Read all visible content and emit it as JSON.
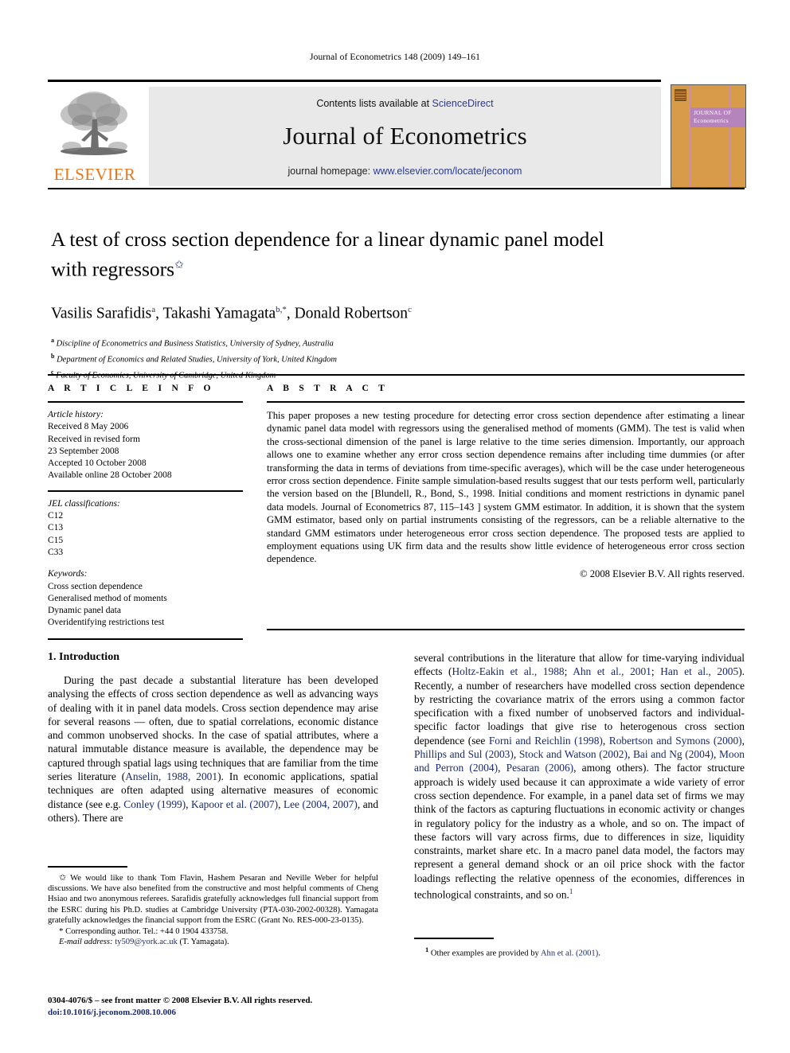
{
  "running_head": "Journal of Econometrics 148 (2009) 149–161",
  "masthead": {
    "contents_prefix": "Contents lists available at ",
    "contents_link": "ScienceDirect",
    "journal_title": "Journal of Econometrics",
    "homepage_prefix": "journal homepage: ",
    "homepage_url": "www.elsevier.com/locate/jeconom",
    "publisher": "ELSEVIER",
    "cover_title_line1": "JOURNAL OF",
    "cover_title_line2": "Econometrics",
    "accent_orange": "#E8761B",
    "band_grey": "#E9E9E9",
    "link_blue": "#2B3A8F",
    "cover_orange": "#D79B4A",
    "cover_purple": "#B584BD"
  },
  "title": {
    "line1": "A test of cross section dependence for a linear dynamic panel model",
    "line2": "with regressors",
    "star_mark": "✩"
  },
  "authors": {
    "full": "Vasilis Sarafidis a, Takashi Yamagata b,*, Donald Robertson c",
    "list": [
      {
        "name": "Vasilis Sarafidis",
        "mark": "a"
      },
      {
        "name": "Takashi Yamagata",
        "mark": "b,*"
      },
      {
        "name": "Donald Robertson",
        "mark": "c"
      }
    ],
    "affiliations": [
      {
        "mark": "a",
        "text": "Discipline of Econometrics and Business Statistics, University of Sydney, Australia"
      },
      {
        "mark": "b",
        "text": "Department of Economics and Related Studies, University of York, United Kingdom"
      },
      {
        "mark": "c",
        "text": "Faculty of Economics, University of Cambridge, United Kingdom"
      }
    ]
  },
  "article_info": {
    "heading": "A R T I C L E   I N F O",
    "history_label": "Article history:",
    "history": [
      "Received 8 May 2006",
      "Received in revised form",
      "23 September 2008",
      "Accepted 10 October 2008",
      "Available online 28 October 2008"
    ],
    "jel_label": "JEL classifications:",
    "jel": [
      "C12",
      "C13",
      "C15",
      "C33"
    ],
    "keywords_label": "Keywords:",
    "keywords": [
      "Cross section dependence",
      "Generalised method of moments",
      "Dynamic panel data",
      "Overidentifying restrictions test"
    ]
  },
  "abstract": {
    "heading": "A B S T R A C T",
    "text": "This paper proposes a new testing procedure for detecting error cross section dependence after estimating a linear dynamic panel data model with regressors using the generalised method of moments (GMM). The test is valid when the cross-sectional dimension of the panel is large relative to the time series dimension. Importantly, our approach allows one to examine whether any error cross section dependence remains after including time dummies (or after transforming the data in terms of deviations from time-specific averages), which will be the case under heterogeneous error cross section dependence. Finite sample simulation-based results suggest that our tests perform well, particularly the version based on the [Blundell, R., Bond, S., 1998. Initial conditions and moment restrictions in dynamic panel data models. Journal of Econometrics 87, 115–143 ] system GMM estimator. In addition, it is shown that the system GMM estimator, based only on partial instruments consisting of the regressors, can be a reliable alternative to the standard GMM estimators under heterogeneous error cross section dependence. The proposed tests are applied to employment equations using UK firm data and the results show little evidence of heterogeneous error cross section dependence.",
    "copyright": "© 2008 Elsevier B.V. All rights reserved."
  },
  "body": {
    "section_number_title": "1.  Introduction",
    "left_paragraph_html": "During the past decade a substantial literature has been developed analysing the effects of cross section dependence as well as advancing ways of dealing with it in panel data models. Cross section dependence may arise for several reasons — often, due to spatial correlations, economic distance and common unobserved shocks. In the case of spatial attributes, where a natural immutable distance measure is available, the dependence may be captured through spatial lags using techniques that are familiar from the time series literature (Anselin, 1988, 2001). In economic applications, spatial techniques are often adapted using alternative measures of economic distance (see e.g. Conley (1999), Kapoor et al. (2007), Lee (2004, 2007), and others). There are",
    "right_paragraph_html": "several contributions in the literature that allow for time-varying individual effects (Holtz-Eakin et al., 1988; Ahn et al., 2001; Han et al., 2005). Recently, a number of researchers have modelled cross section dependence by restricting the covariance matrix of the errors using a common factor specification with a fixed number of unobserved factors and individual-specific factor loadings that give rise to heterogenous cross section dependence (see Forni and Reichlin (1998), Robertson and Symons (2000), Phillips and Sul (2003), Stock and Watson (2002), Bai and Ng (2004), Moon and Perron (2004), Pesaran (2006), among others). The factor structure approach is widely used because it can approximate a wide variety of error cross section dependence. For example, in a panel data set of firms we may think of the factors as capturing fluctuations in economic activity or changes in regulatory policy for the industry as a whole, and so on.  The impact of these factors will vary across firms, due to differences in size, liquidity constraints, market share etc. In a macro panel data model, the factors may represent a general demand shock or an oil price shock with the factor loadings reflecting the relative openness of the economies, differences in technological constraints, and so on.",
    "right_footnote_marker": "1"
  },
  "footnotes": {
    "left_star_mark": "✩",
    "left_star_text": "We would like to thank Tom Flavin, Hashem Pesaran and Neville Weber for helpful discussions. We have also benefited from the constructive and most helpful comments of Cheng Hsiao and two anonymous referees. Sarafidis gratefully acknowledges full financial support from the ESRC during his Ph.D. studies at Cambridge University (PTA-030-2002-00328). Yamagata gratefully acknowledges the financial support from the ESRC (Grant No. RES-000-23-0135).",
    "corresponding_mark": "*",
    "corresponding_text": "Corresponding author. Tel.: +44 0 1904 433758.",
    "email_label": "E-mail address:",
    "email": "ty509@york.ac.uk",
    "email_suffix": "(T. Yamagata).",
    "right_note_number": "1",
    "right_note_text_prefix": "Other examples are provided by ",
    "right_note_citation": "Ahn et al. (2001)",
    "right_note_text_suffix": "."
  },
  "imprint": {
    "line1": "0304-4076/$ – see front matter © 2008 Elsevier B.V. All rights reserved.",
    "doi": "doi:10.1016/j.jeconom.2008.10.006"
  }
}
